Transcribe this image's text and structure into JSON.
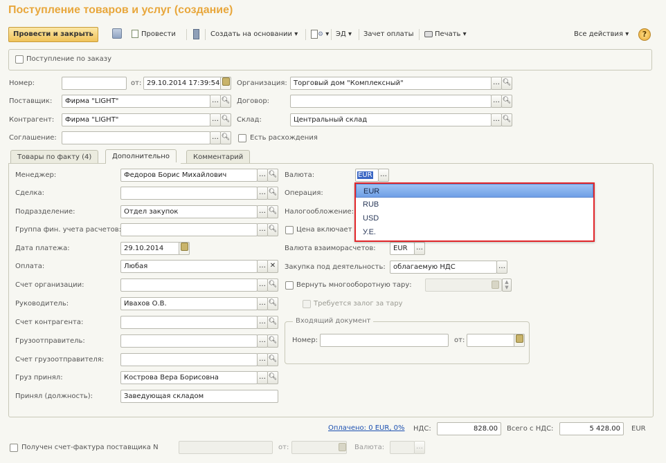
{
  "window": {
    "title": "Поступление товаров и услуг (создание)"
  },
  "toolbar": {
    "post_close": "Провести и закрыть",
    "post": "Провести",
    "create_based": "Создать на основании",
    "ed": "ЭД",
    "payment_offset": "Зачет оплаты",
    "print": "Печать",
    "all_actions": "Все действия",
    "help": "?"
  },
  "order_checkbox": {
    "label": "Поступление по заказу",
    "checked": false
  },
  "header": {
    "number_label": "Номер:",
    "number_value": "",
    "from_label": "от:",
    "date_value": "29.10.2014 17:39:54",
    "org_label": "Организация:",
    "org_value": "Торговый дом \"Комплексный\"",
    "supplier_label": "Поставщик:",
    "supplier_value": "Фирма \"LIGHT\"",
    "contract_label": "Договор:",
    "contract_value": "",
    "counterparty_label": "Контрагент:",
    "counterparty_value": "Фирма \"LIGHT\"",
    "warehouse_label": "Склад:",
    "warehouse_value": "Центральный склад",
    "agreement_label": "Соглашение:",
    "agreement_value": "",
    "discrepancies_label": "Есть расхождения"
  },
  "tabs": [
    {
      "label": "Товары по факту (4)"
    },
    {
      "label": "Дополнительно"
    },
    {
      "label": "Комментарий"
    }
  ],
  "left": {
    "manager_label": "Менеджер:",
    "manager_value": "Федоров Борис Михайлович",
    "deal_label": "Сделка:",
    "deal_value": "",
    "department_label": "Подразделение:",
    "department_value": "Отдел закупок",
    "fin_group_label": "Группа фин. учета расчетов:",
    "fin_group_value": "",
    "pay_date_label": "Дата платежа:",
    "pay_date_value": "29.10.2014",
    "payment_label": "Оплата:",
    "payment_value": "Любая",
    "org_account_label": "Счет организации:",
    "org_account_value": "",
    "head_label": "Руководитель:",
    "head_value": "Ивахов О.В.",
    "cp_account_label": "Счет контрагента:",
    "cp_account_value": "",
    "shipper_label": "Грузоотправитель:",
    "shipper_value": "",
    "shipper_account_label": "Счет грузоотправителя:",
    "shipper_account_value": "",
    "received_label": "Груз принял:",
    "received_value": "Кострова Вера Борисовна",
    "position_label": "Принял (должность):",
    "position_value": "Заведующая складом"
  },
  "right": {
    "currency_label": "Валюта:",
    "currency_value": "EUR",
    "operation_label": "Операция:",
    "taxation_label": "Налогообложение:",
    "price_includes_label": "Цена включает",
    "settle_currency_label": "Валюта взаиморасчетов:",
    "settle_currency_value": "EUR",
    "purchase_label": "Закупка под деятельность:",
    "purchase_value": "облагаемую НДС",
    "return_tare_label": "Вернуть многооборотную тару:",
    "deposit_label": "Требуется залог за тару",
    "incoming_doc_title": "Входящий документ",
    "doc_number_label": "Номер:",
    "doc_from_label": "от:"
  },
  "currency_dropdown": {
    "options": [
      "EUR",
      "RUB",
      "USD",
      "У.Е."
    ],
    "selected": "EUR"
  },
  "footer": {
    "paid_link": "Оплачено: 0 EUR, 0%",
    "vat_label": "НДС:",
    "vat_value": "828.00",
    "total_label": "Всего с НДС:",
    "total_value": "5 428.00",
    "currency": "EUR",
    "invoice_label": "Получен счет-фактура поставщика N",
    "invoice_from_label": "от:",
    "invoice_currency_label": "Валюта:"
  },
  "colors": {
    "accent_title": "#e8a73c",
    "dropdown_border": "#e2262a",
    "primary_button": "#f0c35a",
    "link": "#1b4fb0"
  }
}
